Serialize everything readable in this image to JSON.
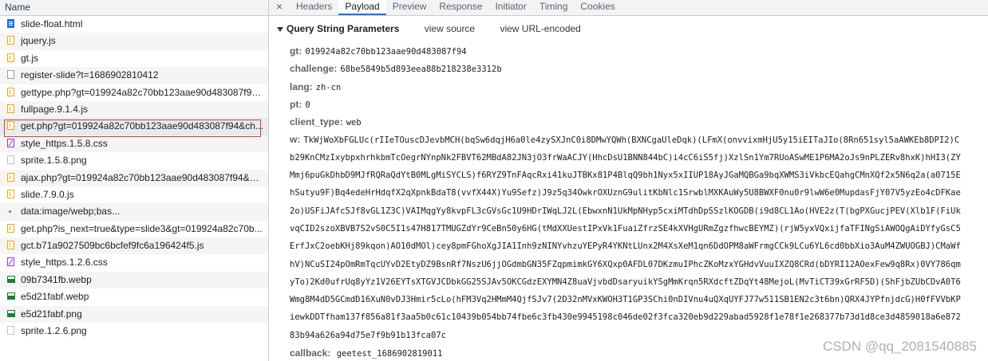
{
  "network": {
    "column_name": "Name",
    "requests": [
      {
        "name": "slide-float.html",
        "icon": "document-icon"
      },
      {
        "name": "jquery.js",
        "icon": "script-icon"
      },
      {
        "name": "gt.js",
        "icon": "script-icon"
      },
      {
        "name": "register-slide?t=1686902810412",
        "icon": "xhr-icon"
      },
      {
        "name": "gettype.php?gt=019924a82c70bb123aae90d483087f94...",
        "icon": "script-icon"
      },
      {
        "name": "fullpage.9.1.4.js",
        "icon": "script-icon"
      },
      {
        "name": "get.php?gt=019924a82c70bb123aae90d483087f94&ch...",
        "icon": "script-icon"
      },
      {
        "name": "style_https.1.5.8.css",
        "icon": "stylesheet-icon"
      },
      {
        "name": "sprite.1.5.8.png",
        "icon": "image-icon"
      },
      {
        "name": "ajax.php?gt=019924a82c70bb123aae90d483087f94&ch...",
        "icon": "script-icon"
      },
      {
        "name": "slide.7.9.0.js",
        "icon": "script-icon"
      },
      {
        "name": "data:image/webp;bas...",
        "icon": "data-icon"
      },
      {
        "name": "get.php?is_next=true&type=slide3&gt=019924a82c70b...",
        "icon": "script-icon"
      },
      {
        "name": "gct.b71a9027509bc6bcfef9fc6a196424f5.js",
        "icon": "script-icon"
      },
      {
        "name": "style_https.1.2.6.css",
        "icon": "stylesheet-icon"
      },
      {
        "name": "09b7341fb.webp",
        "icon": "image-icon"
      },
      {
        "name": "e5d21fabf.webp",
        "icon": "image-icon"
      },
      {
        "name": "e5d21fabf.png",
        "icon": "image-icon"
      },
      {
        "name": "sprite.1.2.6.png",
        "icon": "image-icon"
      }
    ]
  },
  "tabs": {
    "close": "×",
    "items": [
      "Headers",
      "Payload",
      "Preview",
      "Response",
      "Initiator",
      "Timing",
      "Cookies"
    ],
    "active": "Payload"
  },
  "payload": {
    "section_title": "Query String Parameters",
    "view_source": "view source",
    "view_url_encoded": "view URL-encoded",
    "params": [
      {
        "key": "gt:",
        "value": "019924a82c70bb123aae90d483087f94"
      },
      {
        "key": "challenge:",
        "value": "68be5849b5d893eea88b218238e3312b"
      },
      {
        "key": "lang:",
        "value": "zh-cn"
      },
      {
        "key": "pt:",
        "value": "0"
      },
      {
        "key": "client_type:",
        "value": "web"
      }
    ],
    "w_key": "w:",
    "w_lines": [
      "TkWjWoXbFGLUc(rIIeTOuscDJevbMCH(bqSw6dqjH6a0le4zySXJnC0i8DMwYQWh(BXNCgaUleDqk)(LFmX(onvvixmHjU5y15iEITaJIo(8Rn651syl5aAWKEb8DPI2)C",
      "b29KnCMzIxybpxhrhkbmTcOegrNYnpNk2FBVT62MBdA82JN3jO3frWaACJY(HhcDsU1BNN844bC)i4cC6iS5fj)XzlSn1Ym7RUoASwME1P6MA2oJs9nPLZERv8hxK)hHI3(ZY",
      "Mmj6puGkDhbD9MJfRQRaQdYtB0MLgMiSYCLS)f6RYZ9TnFAqcRxi41kuJTBKx81P4BlqQ9bh1Nyx5xIIUP18AyJGaMQBGa9bqXWMS3iVkbcEQahgCMnXQf2x5N6q2a(a0715E",
      "hSutyu9F)Bq4edeHrHdqfX2qXpnkBdaT8(vvfX44X)Yu9Sefz)J9z5q34OwkrOXUznG9ulitKbNlc1SrwblMXKAuWy5U8BWXF0nu0r9lwW6e0MupdasFjY07V5yzEo4cDFKae",
      "2o)USFiJAfc5Jf8vGL1Z3C)VAIMqgYy8kvpFL3cGVsGc1U9HDrIWqLJ2L(EbwxnN1UkMpNHyp5cxiMTdhDpSSzlKOGDB(i9d8CL1Ao(HVE2z(T(bgPXGucjPEV(Xlb1F(FiUk",
      "vqCID2szoXBVB7S2vS0C5I1s47H817TMUGZdYr9CeBnS0y6HG(tMdXXUestIPxVk1FuaiZfrzSE4kXVHgURmZgzfhwcBEYMZ)(rjW5yxVQxijfaTFINgSiAWOQgAiDYfyGsC5",
      "ErfJxC2oebKHj89kqon)AO10dMOl)cey8pmFGhoXgJIA1Inh9zNINYvhzuYEPyR4YKNtLUnx2M4XsXeM1qn6DdOPM8aWFrmgCCk9LCu6YL6cd0bbXio3AuM4ZWUOGBJ)CMaWf",
      "hV)NCuSI24pOmRmTqcUYvD2EtyDZ9BsnRf7NszU6jjOGdmbGN35FZqpmimkGY6XQxp0AFDL07DKzmuIPhcZKoMzxYGHdvVuuIXZQ8CRd(bDYRI12AOexFew9q8Rx)0VY786qm",
      "yTo)2Kd0ufrUq8yYz1V26EYTsXTGVJCDbkGG25SJAv5OKCGdzEXYMN4Z8uaVjvbdDsaryuikYSgMmKrqn5RXdcftZDqYt48MejoL(MvTiCT39xGrRF5D)(ShFjbZUbCDvA0T6",
      "Wmg8M4dD5GCmdD16XuN0vDJ3Hmir5cLo(hFM3Vq2HMmM4QjfSJv7(2D32nMVxKWOH3T1GP3SChi0nDIVnu4uQXqUYFJ77w511SB1EN2c3t6bn)QRX4JYPfnjdcG)H0fFVVbKP",
      "iewkDDTfham137f856a81f3aa5b0c61c10439b054bb74fbe6c3fb430e9945198c046de02f3fca320eb9d229abad5928f1e78f1e268377b73d1d8ce3d4859018a6e872",
      "83b94a626a94d75e7f9b91b13fca07c"
    ],
    "callback_key": "callback:",
    "callback_value": "geetest_1686902819011"
  },
  "watermark": "CSDN @qq_2081540885",
  "colors": {
    "accent": "#1a73e8",
    "selection_outline": "#e53935"
  }
}
